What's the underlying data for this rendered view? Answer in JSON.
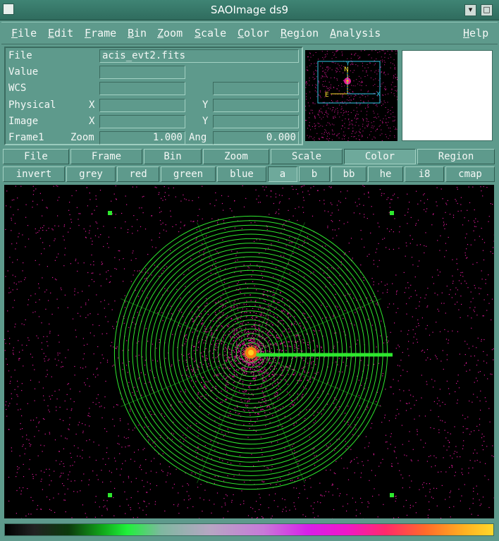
{
  "window": {
    "title": "SAOImage ds9",
    "min_glyph": "▾",
    "max_glyph": "□"
  },
  "menubar": {
    "file": "File",
    "edit": "Edit",
    "frame": "Frame",
    "bin": "Bin",
    "zoom": "Zoom",
    "scale": "Scale",
    "color": "Color",
    "region": "Region",
    "analysis": "Analysis",
    "help": "Help"
  },
  "info": {
    "file_label": "File",
    "file_value": "acis_evt2.fits",
    "value_label": "Value",
    "wcs_label": "WCS",
    "physical_label": "Physical",
    "image_label": "Image",
    "x_label": "X",
    "y_label": "Y",
    "frame_label": "Frame1",
    "zoom_label": "Zoom",
    "zoom_value": "1.000",
    "ang_label": "Ang",
    "ang_value": "0.000"
  },
  "panner": {
    "north_label": "N",
    "east_label": "E",
    "x_label": "X",
    "y_label": "Y"
  },
  "buttonbar": {
    "row1": [
      "File",
      "Frame",
      "Bin",
      "Zoom",
      "Scale",
      "Color",
      "Region"
    ],
    "row1_active": "Color",
    "row2": [
      "invert",
      "grey",
      "red",
      "green",
      "blue",
      "a",
      "b",
      "bb",
      "he",
      "i8",
      "cmap"
    ],
    "row2_active": "a"
  },
  "colors": {
    "background": "#5e9a8c",
    "region_green": "#2ee82e",
    "source_magenta": "#e01a9a"
  },
  "colorbar": {
    "colormap": "a"
  }
}
